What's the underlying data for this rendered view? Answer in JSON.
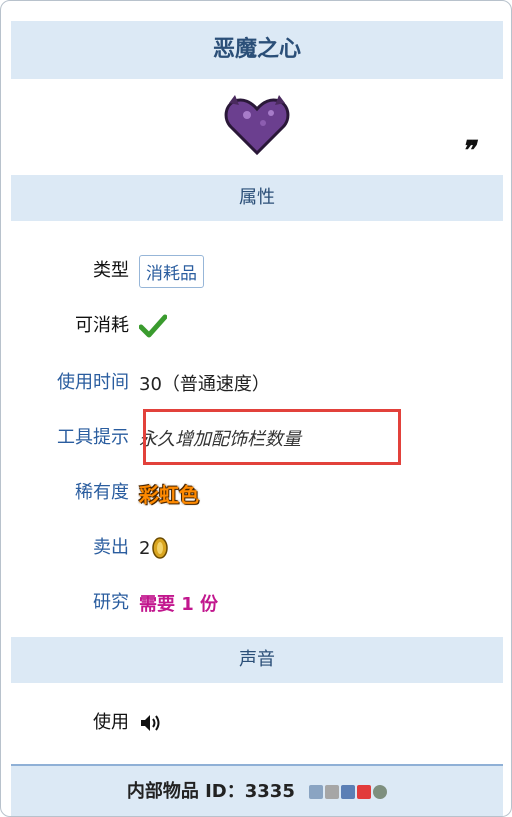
{
  "item": {
    "title": "恶魔之心",
    "quote_mark": "❞"
  },
  "sections": {
    "attributes": "属性",
    "sound": "声音"
  },
  "rows": {
    "type": {
      "label": "类型",
      "value": "消耗品"
    },
    "consumable": {
      "label": "可消耗",
      "value_icon": "check-icon"
    },
    "use_time": {
      "label": "使用时间",
      "value": "30（普通速度）"
    },
    "tooltip": {
      "label": "工具提示",
      "value": "永久增加配饰栏数量"
    },
    "rarity": {
      "label": "稀有度",
      "value": "彩虹色"
    },
    "sell": {
      "label": "卖出",
      "value": "2"
    },
    "research": {
      "label": "研究",
      "value": "需要 1 份"
    },
    "use_sound": {
      "label": "使用"
    }
  },
  "footer": {
    "text": "内部物品 ID：3335"
  },
  "colors": {
    "band": "#dce9f5",
    "link": "#2a5d9f",
    "highlight_box": "#e2413b",
    "rarity": "#ff8a00",
    "research": "#c2178e"
  }
}
